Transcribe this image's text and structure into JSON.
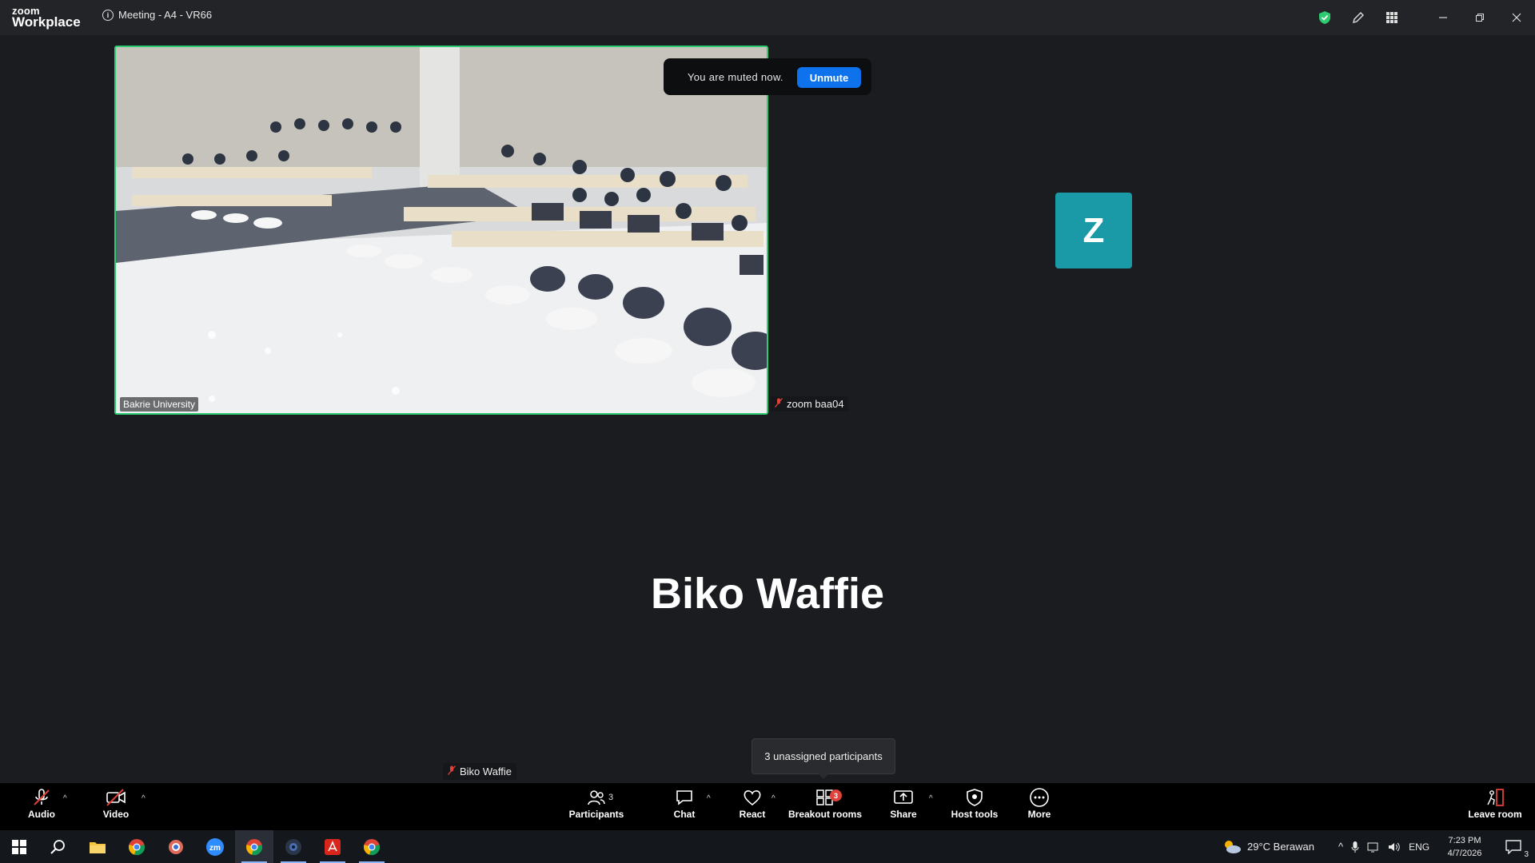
{
  "app": {
    "brand_line1": "zoom",
    "brand_line2": "Workplace"
  },
  "meeting": {
    "title": "Meeting - A4 - VR66"
  },
  "toast": {
    "message": "You are muted now.",
    "button": "Unmute"
  },
  "tiles": {
    "main_video_name": "Bakrie University",
    "side_name": "zoom baa04",
    "avatar_letter": "Z",
    "speaker_name": "Biko Waffie",
    "bottom_name": "Biko Waffie"
  },
  "tooltip": {
    "text": "3 unassigned participants"
  },
  "toolbar": {
    "audio": "Audio",
    "video": "Video",
    "participants": "Participants",
    "participants_count": "3",
    "chat": "Chat",
    "react": "React",
    "breakout": "Breakout rooms",
    "breakout_badge": "3",
    "share": "Share",
    "host_tools": "Host tools",
    "more": "More",
    "leave": "Leave room"
  },
  "taskbar": {
    "weather": "29°C  Berawan",
    "lang": "ENG",
    "time": "7:23 PM",
    "date": "4/7/2026",
    "notif_count": "3"
  },
  "colors": {
    "accent_green": "#2ecc71",
    "unmute_blue": "#0e72ed",
    "avatar_teal": "#1a9aa6",
    "alert_red": "#e0413a"
  }
}
